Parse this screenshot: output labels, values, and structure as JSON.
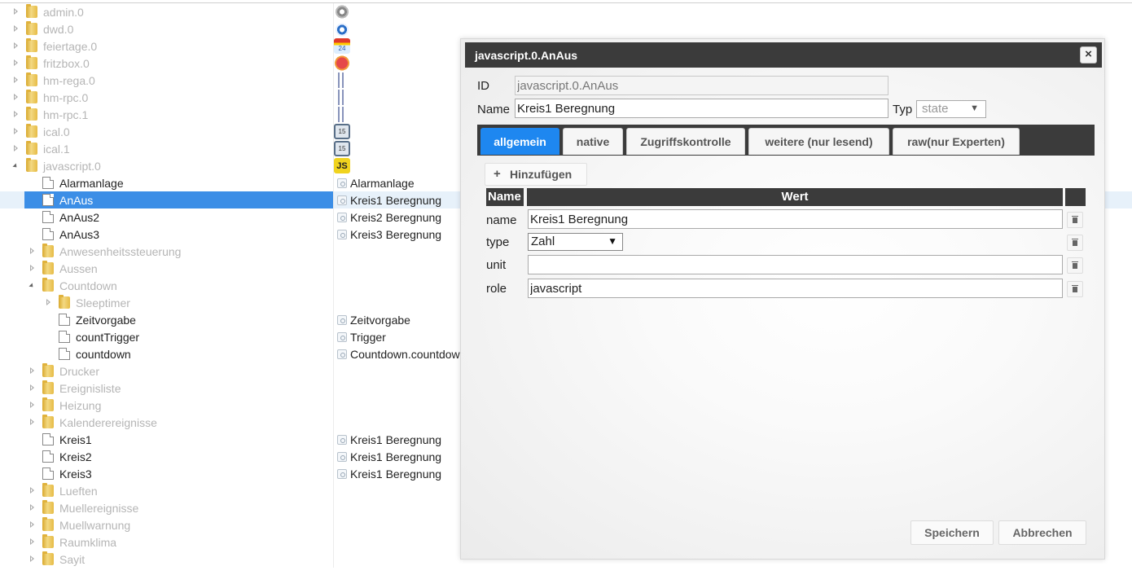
{
  "tree": {
    "items": [
      {
        "label": "admin.0",
        "icon": "admin-gear-icon",
        "level": 0
      },
      {
        "label": "dwd.0",
        "icon": "dwd-weather-icon",
        "level": 0
      },
      {
        "label": "feiertage.0",
        "icon": "feiertage-calendar-icon",
        "icon_text": "24",
        "level": 0
      },
      {
        "label": "fritzbox.0",
        "icon": "fritzbox-icon",
        "level": 0
      },
      {
        "label": "hm-rega.0",
        "icon": "homematic-icon",
        "level": 0
      },
      {
        "label": "hm-rpc.0",
        "icon": "homematic-icon",
        "level": 0
      },
      {
        "label": "hm-rpc.1",
        "icon": "homematic-icon",
        "level": 0
      },
      {
        "label": "ical.0",
        "icon": "ical-calendar-icon",
        "icon_text": "15",
        "level": 0
      },
      {
        "label": "ical.1",
        "icon": "ical-calendar-icon",
        "icon_text": "15",
        "level": 0
      },
      {
        "label": "javascript.0",
        "icon": "javascript-icon",
        "icon_text": "JS",
        "level": 0
      },
      {
        "label": "Alarmanlage",
        "value": "Alarmanlage",
        "level": 1
      },
      {
        "label": "AnAus",
        "value": "Kreis1 Beregnung",
        "level": 1
      },
      {
        "label": "AnAus2",
        "value": "Kreis2 Beregnung",
        "level": 1
      },
      {
        "label": "AnAus3",
        "value": "Kreis3 Beregnung",
        "level": 1
      },
      {
        "label": "Anwesenheitssteuerung",
        "level": 1
      },
      {
        "label": "Aussen",
        "level": 1
      },
      {
        "label": "Countdown",
        "level": 1
      },
      {
        "label": "Sleeptimer",
        "level": 2
      },
      {
        "label": "Zeitvorgabe",
        "value": "Zeitvorgabe",
        "level": 2
      },
      {
        "label": "countTrigger",
        "value": "Trigger",
        "level": 2
      },
      {
        "label": "countdown",
        "value": "Countdown.countdown",
        "level": 2
      },
      {
        "label": "Drucker",
        "level": 1
      },
      {
        "label": "Ereignisliste",
        "level": 1
      },
      {
        "label": "Heizung",
        "level": 1
      },
      {
        "label": "Kalenderereignisse",
        "level": 1
      },
      {
        "label": "Kreis1",
        "value": "Kreis1 Beregnung",
        "level": 1
      },
      {
        "label": "Kreis2",
        "value": "Kreis1 Beregnung",
        "level": 1
      },
      {
        "label": "Kreis3",
        "value": "Kreis1 Beregnung",
        "level": 1
      },
      {
        "label": "Lueften",
        "level": 1
      },
      {
        "label": "Muellereignisse",
        "level": 1
      },
      {
        "label": "Muellwarnung",
        "level": 1
      },
      {
        "label": "Raumklima",
        "level": 1
      },
      {
        "label": "Sayit",
        "level": 1
      }
    ]
  },
  "dialog": {
    "title": "javascript.0.AnAus",
    "close_label": "×",
    "id_label": "ID",
    "id_value": "javascript.0.AnAus",
    "name_label": "Name",
    "name_value": "Kreis1 Beregnung",
    "typ_label": "Typ",
    "typ_value": "state",
    "tabs": [
      {
        "label": "allgemein",
        "active": true
      },
      {
        "label": "native"
      },
      {
        "label": "Zugriffskontrolle"
      },
      {
        "label": "weitere (nur lesend)"
      },
      {
        "label": "raw(nur Experten)"
      }
    ],
    "add_label": "Hinzufügen",
    "table": {
      "col_name": "Name",
      "col_value": "Wert",
      "rows": [
        {
          "name": "name",
          "value": "Kreis1 Beregnung"
        },
        {
          "name": "type",
          "value": "Zahl"
        },
        {
          "name": "unit",
          "value": ""
        },
        {
          "name": "role",
          "value": "javascript"
        }
      ]
    },
    "save_label": "Speichern",
    "cancel_label": "Abbrechen"
  },
  "colors": {
    "accent": "#1e87f0",
    "header": "#3b3b3b",
    "selection": "#3c8ee6",
    "dim_text": "#b5b5b5"
  }
}
